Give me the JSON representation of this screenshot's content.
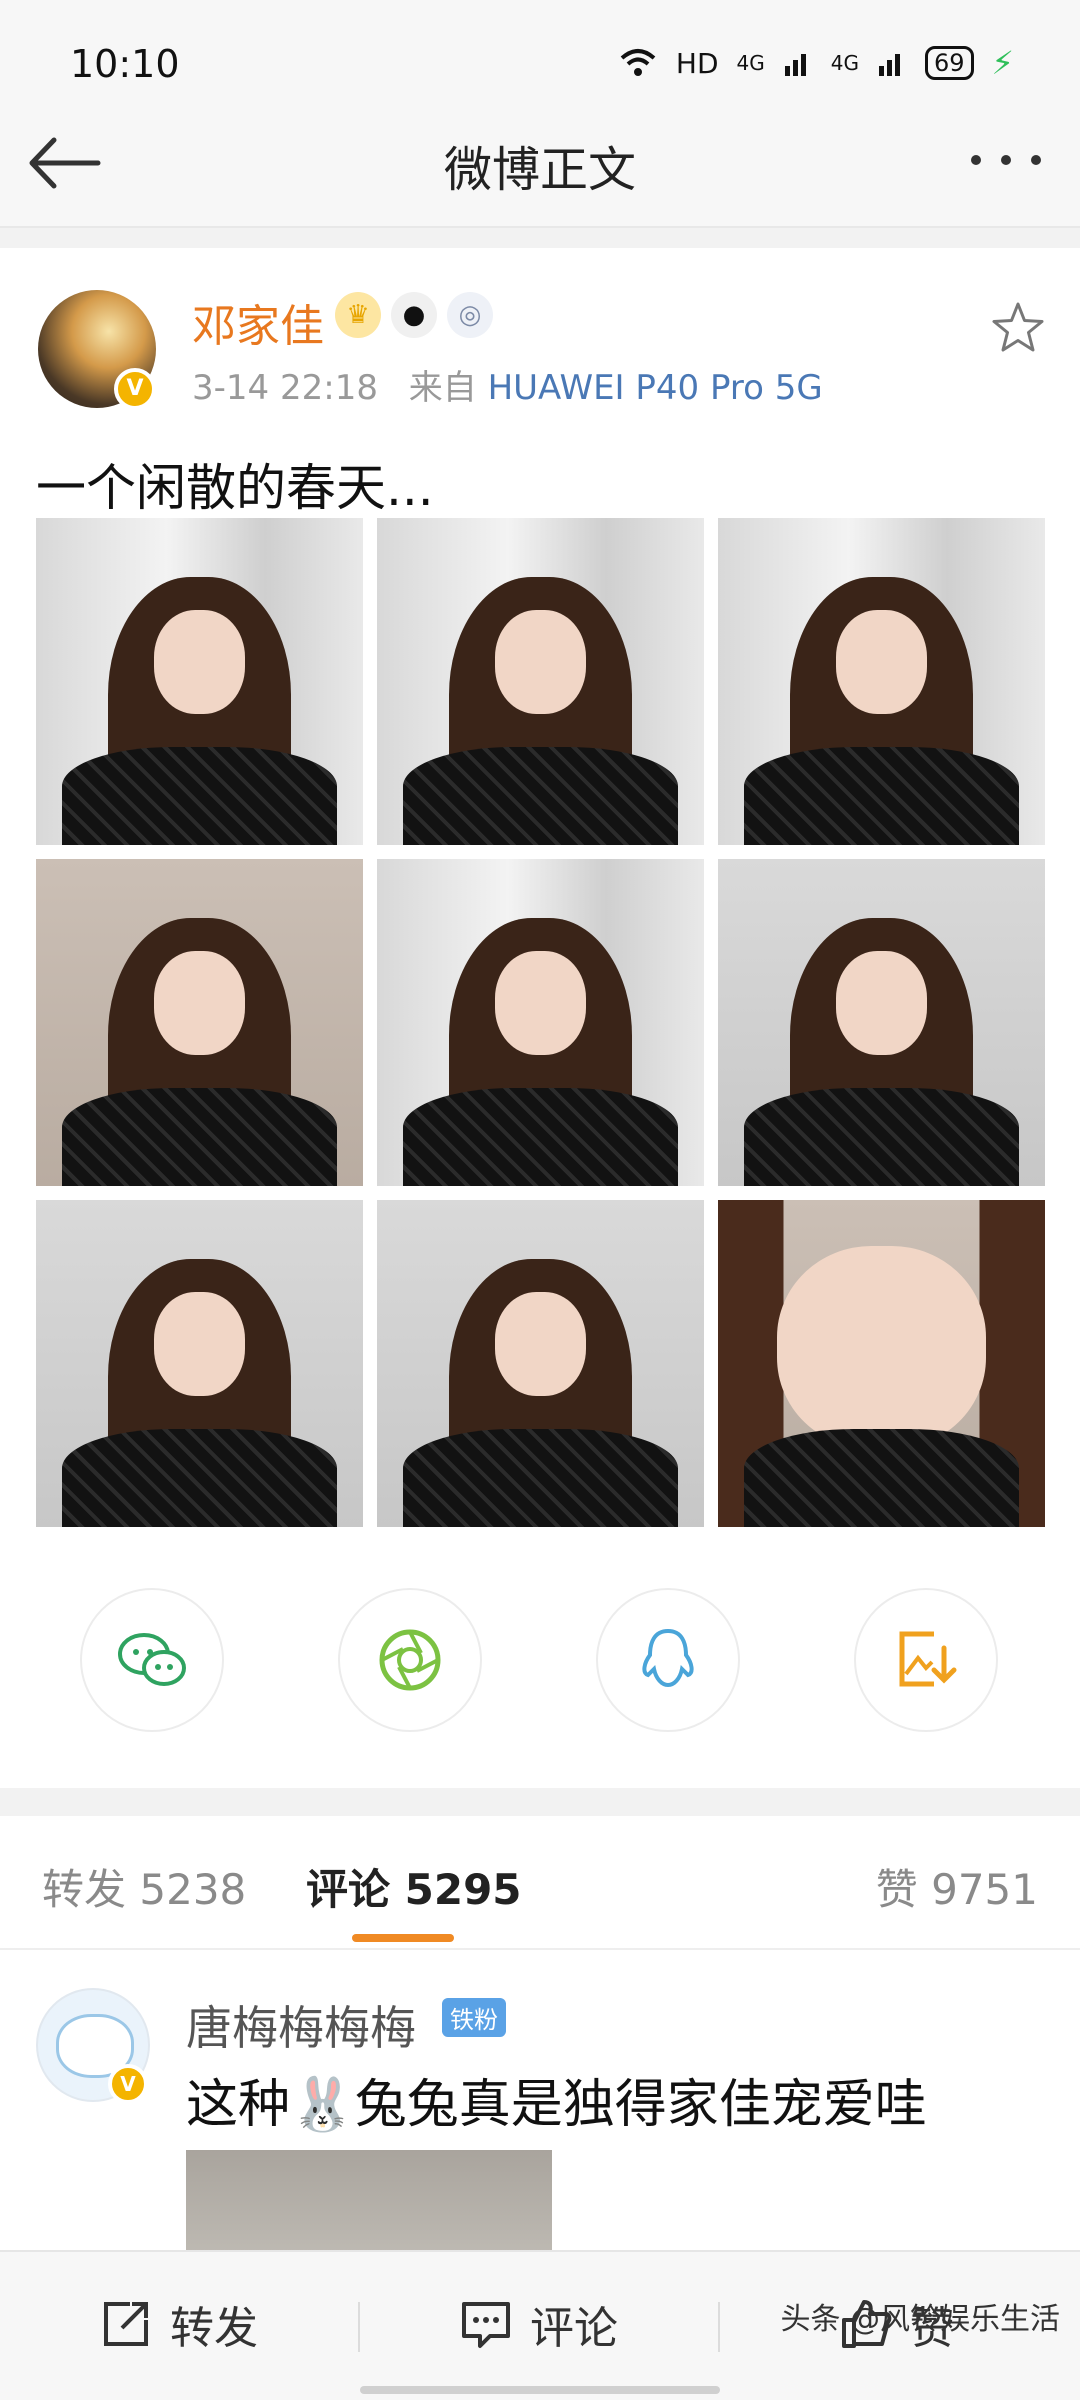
{
  "status_bar": {
    "time": "10:10",
    "network": "HD",
    "signal_1": "4G",
    "signal_2": "4G",
    "battery": "69"
  },
  "header": {
    "title": "微博正文"
  },
  "post": {
    "author": "邓家佳",
    "timestamp": "3-14 22:18",
    "source_prefix": "来自",
    "device": "HUAWEI P40 Pro 5G",
    "text": "一个闲散的春天...",
    "photo_count": 9
  },
  "share": {
    "items": [
      {
        "icon": "wechat-icon",
        "color": "#2fa360"
      },
      {
        "icon": "moments-icon",
        "color": "#7cc242"
      },
      {
        "icon": "qq-icon",
        "color": "#4aa5d9"
      },
      {
        "icon": "save-image-icon",
        "color": "#f0a11e"
      }
    ]
  },
  "tabs": {
    "repost_label": "转发",
    "repost_count": "5238",
    "comment_label": "评论",
    "comment_count": "5295",
    "like_label": "赞",
    "like_count": "9751"
  },
  "comment": {
    "name": "唐梅梅梅梅",
    "fan_badge": "铁粉",
    "text_before": "这种",
    "emoji": "🐰",
    "text_after": "兔兔真是独得家佳宠爱哇"
  },
  "bottom_bar": {
    "repost": "转发",
    "comment": "评论",
    "like": "赞"
  },
  "watermark": "头条 @风铃娱乐生活",
  "colors": {
    "author": "#e8781f",
    "link": "#4a78b5",
    "accent": "#f08a24"
  }
}
